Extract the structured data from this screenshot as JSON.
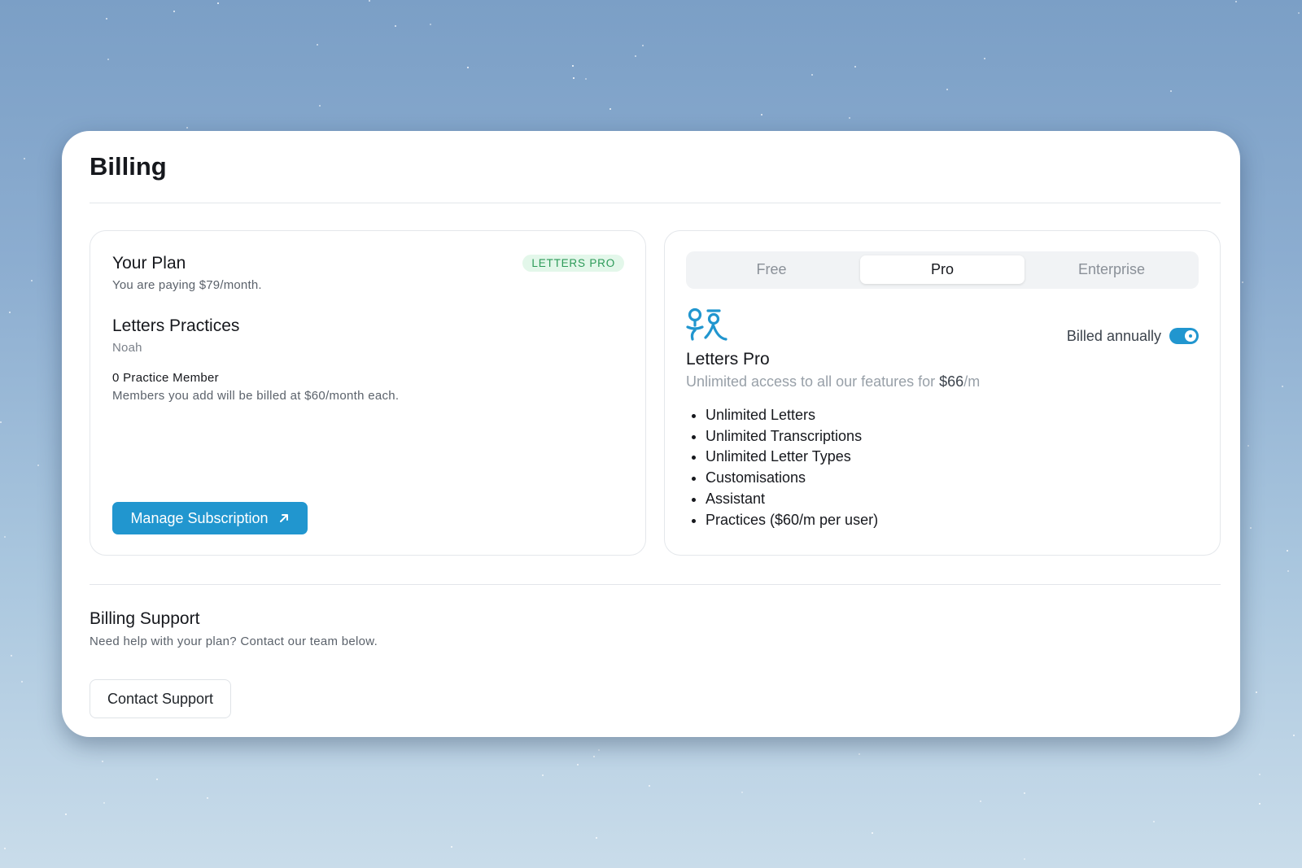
{
  "page": {
    "title": "Billing"
  },
  "plan": {
    "title": "Your Plan",
    "subtitle": "You are paying $79/month.",
    "badge": "LETTERS PRO",
    "practice_name": "Letters Practices",
    "practice_owner": "Noah",
    "member_count": "0 Practice Member",
    "member_note": "Members you add will be billed at $60/month each.",
    "manage_label": "Manage Subscription"
  },
  "tiers": {
    "tabs": [
      {
        "label": "Free",
        "selected": false
      },
      {
        "label": "Pro",
        "selected": true
      },
      {
        "label": "Enterprise",
        "selected": false
      }
    ],
    "billed_label": "Billed annually",
    "billed_annually": true,
    "name": "Letters Pro",
    "description": "Unlimited access to all our features for",
    "price": "$66",
    "price_suffix": "/m",
    "features": [
      "Unlimited Letters",
      "Unlimited Transcriptions",
      "Unlimited Letter Types",
      "Customisations",
      "Assistant",
      "Practices ($60/m per user)"
    ]
  },
  "support": {
    "title": "Billing Support",
    "subtitle": "Need help with your plan? Contact our team below.",
    "contact_label": "Contact Support"
  },
  "colors": {
    "accent": "#2196cf",
    "badge_bg": "#e3f7ea",
    "badge_text": "#2c9a58"
  },
  "icons": {
    "logo": "letters-logo-icon",
    "external": "arrow-up-right-icon"
  }
}
